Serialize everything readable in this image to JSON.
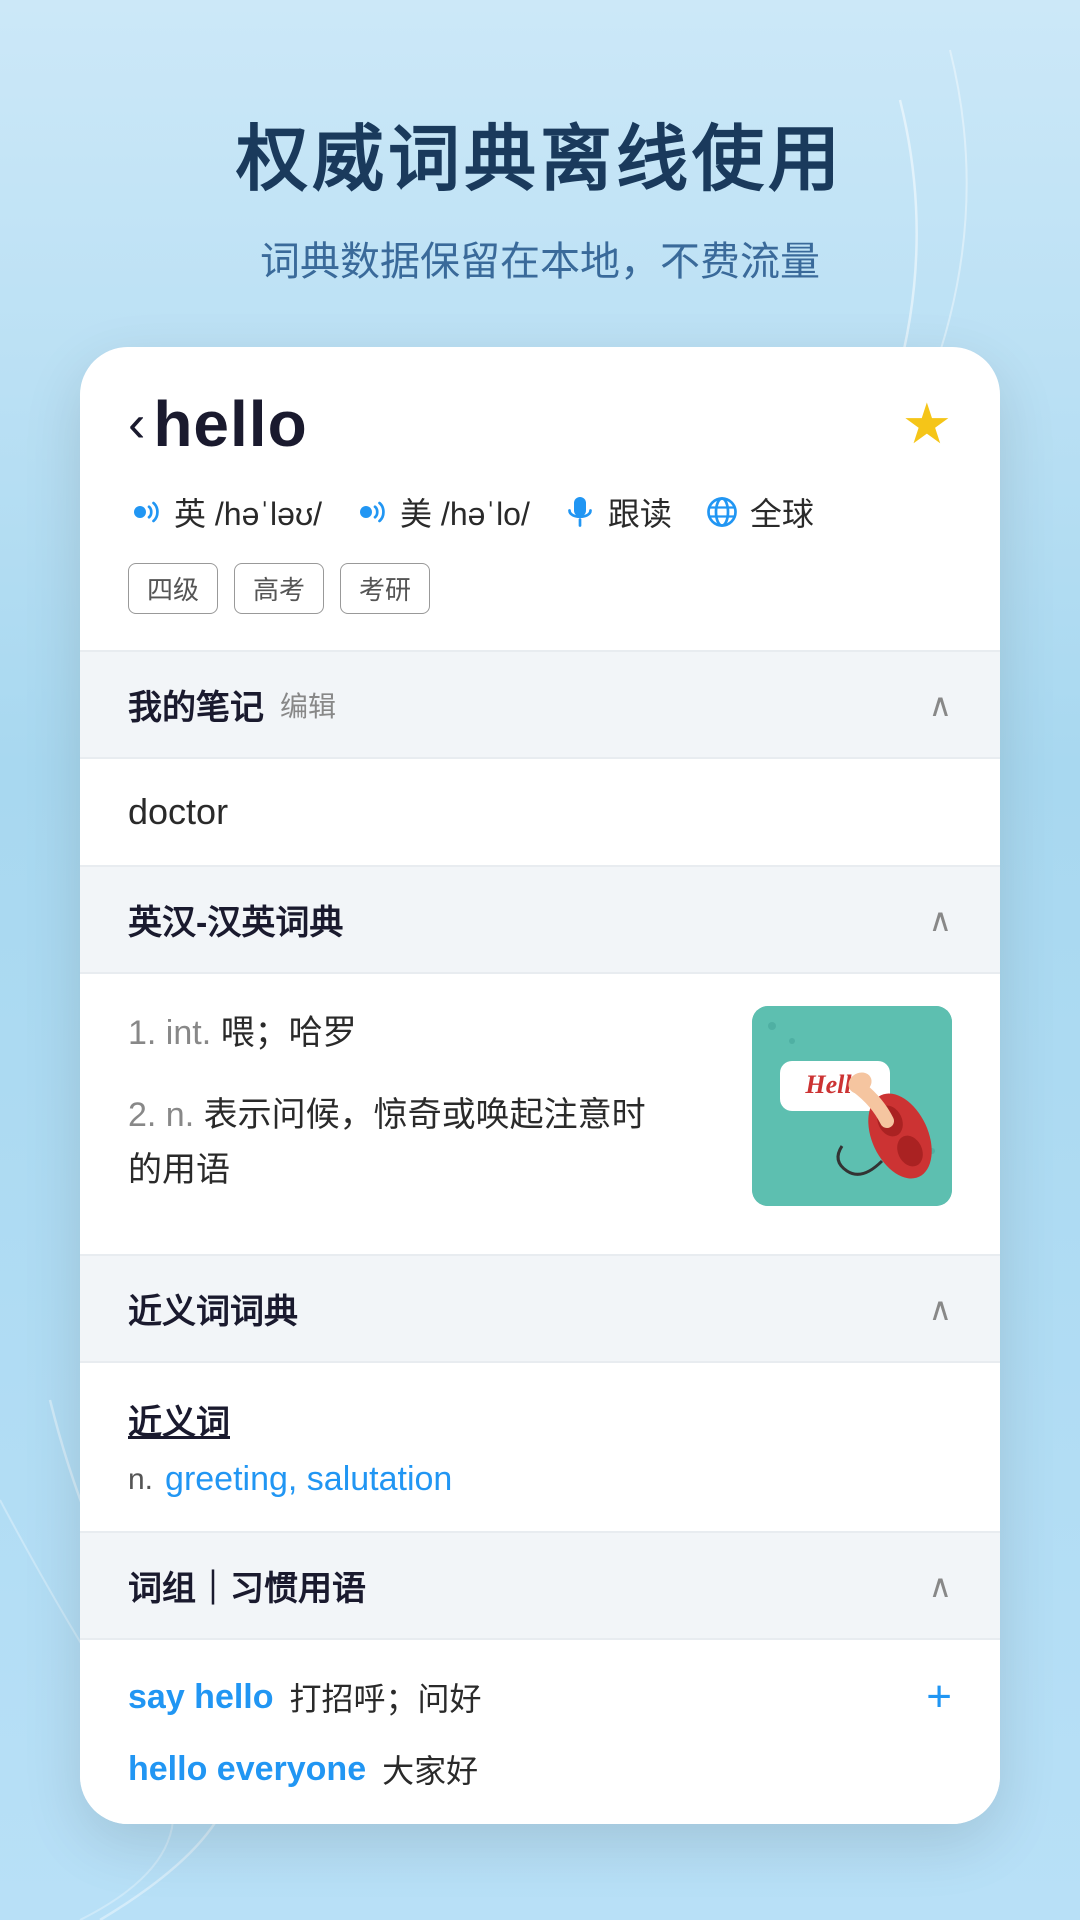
{
  "background": {
    "headline": "权威词典离线使用",
    "subline": "词典数据保留在本地，不费流量"
  },
  "word": {
    "back_symbol": "‹",
    "word_text": "hello",
    "star": "★",
    "phonetics": [
      {
        "region": "英",
        "ipa": "/həˈləʊ/"
      },
      {
        "region": "美",
        "ipa": "/həˈlo/"
      }
    ],
    "actions": [
      {
        "label": "跟读"
      },
      {
        "label": "全球"
      }
    ],
    "tags": [
      "四级",
      "高考",
      "考研"
    ]
  },
  "sections": {
    "notes": {
      "title": "我的笔记",
      "edit_label": "编辑",
      "content": "doctor"
    },
    "dictionary": {
      "title": "英汉-汉英词典",
      "definitions": [
        {
          "num": "1.",
          "pos": "int.",
          "def": "喂；哈罗"
        },
        {
          "num": "2.",
          "pos": "n.",
          "def": "表示问候，惊奇或唤起注意时的用语"
        }
      ]
    },
    "synonyms": {
      "title": "近义词词典",
      "label": "近义词",
      "pos": "n.",
      "words": "greeting, salutation"
    },
    "phrases": {
      "title": "词组｜习惯用语",
      "items": [
        {
          "en": "say hello",
          "cn": "打招呼；问好",
          "has_plus": true
        },
        {
          "en": "hello everyone",
          "cn": "大家好",
          "has_plus": false
        }
      ]
    }
  }
}
